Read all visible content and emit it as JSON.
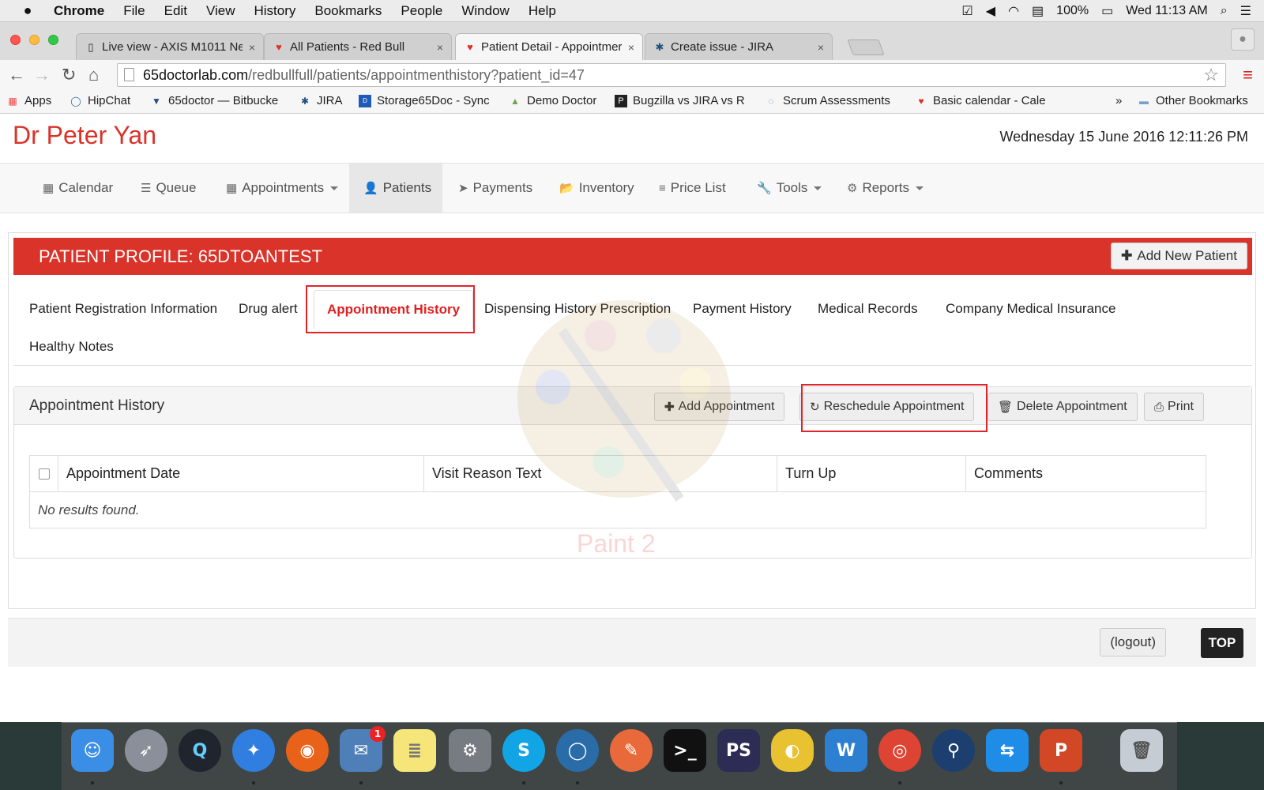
{
  "menubar": {
    "items": [
      "Chrome",
      "File",
      "Edit",
      "View",
      "History",
      "Bookmarks",
      "People",
      "Window",
      "Help"
    ],
    "battery": "100%",
    "clock": "Wed 11:13 AM"
  },
  "tabs": [
    {
      "title": "Live view - AXIS M1011 Ne",
      "close": "×"
    },
    {
      "title": "All Patients - Red Bull",
      "close": "×"
    },
    {
      "title": "Patient Detail - Appointmer",
      "close": "×"
    },
    {
      "title": "Create issue - JIRA",
      "close": "×"
    }
  ],
  "address": {
    "host": "65doctorlab.com",
    "path": "/redbullfull/patients/appointmenthistory?patient_id=47"
  },
  "bookmarks": [
    "Apps",
    "HipChat",
    "65doctor — Bitbucke",
    "JIRA",
    "Storage65Doc - Sync",
    "Demo Doctor",
    "Bugzilla vs JIRA vs R",
    "Scrum Assessments",
    "Basic calendar - Cale",
    "»",
    "Other Bookmarks"
  ],
  "page": {
    "doctor": "Dr Peter Yan",
    "datetime": "Wednesday 15 June 2016 12:11:26 PM"
  },
  "nav": [
    {
      "icon": "▦",
      "label": "Calendar"
    },
    {
      "icon": "☰",
      "label": "Queue"
    },
    {
      "icon": "▦",
      "label": "Appointments"
    },
    {
      "icon": "👤",
      "label": "Patients"
    },
    {
      "icon": "➤",
      "label": "Payments"
    },
    {
      "icon": "📂",
      "label": "Inventory"
    },
    {
      "icon": "≡",
      "label": "Price List"
    },
    {
      "icon": "🔧",
      "label": "Tools"
    },
    {
      "icon": "⚙",
      "label": "Reports"
    }
  ],
  "profile": {
    "title": "PATIENT PROFILE: 65DTOANTEST",
    "add_patient": "Add New Patient"
  },
  "profile_tabs": [
    "Patient Registration Information",
    "Drug alert",
    "Appointment History",
    "Dispensing History Prescription",
    "Payment History",
    "Medical Records",
    "Company Medical Insurance",
    "Healthy Notes"
  ],
  "history": {
    "title": "Appointment History",
    "buttons": {
      "add": "Add Appointment",
      "reschedule": "Reschedule Appointment",
      "delete": "Delete Appointment",
      "print": "Print"
    },
    "columns": [
      "Appointment Date",
      "Visit Reason Text",
      "Turn Up",
      "Comments"
    ],
    "empty": "No results found."
  },
  "watermark": "Paint 2",
  "footer": {
    "logout": "(logout)",
    "top": "TOP"
  },
  "dock": {
    "mail_badge": "1"
  },
  "colors": {
    "brand_red": "#d9332a",
    "highlight_frame": "#e0252a"
  }
}
